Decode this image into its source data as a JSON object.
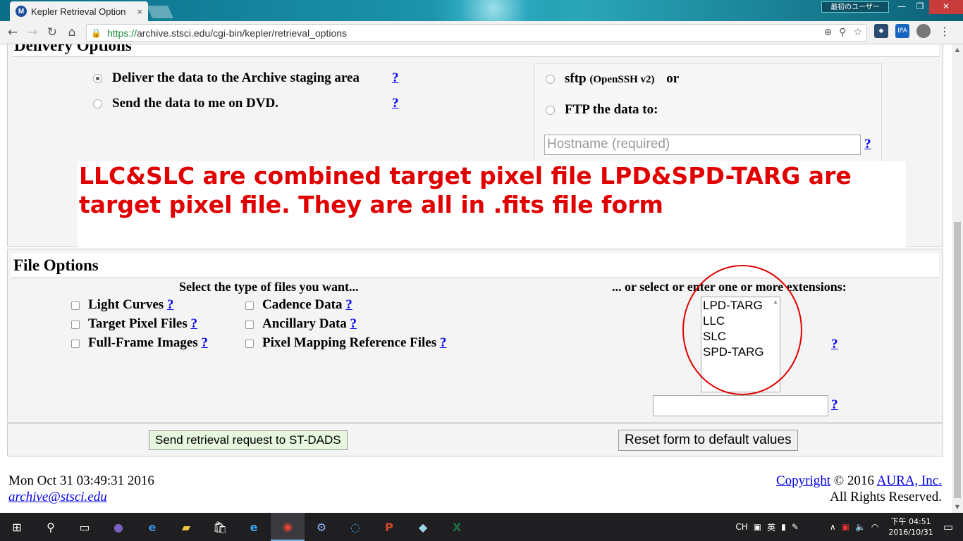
{
  "browser": {
    "tab_title": "Kepler Retrieval Option",
    "tab_close": "×",
    "url_scheme": "https://",
    "url_rest": "archive.stsci.edu/cgi-bin/kepler/retrieval_options",
    "user_label": "最初のユーザー",
    "ext_ipa": "IPA",
    "favicon_letter": "M"
  },
  "delivery": {
    "title": "Delivery Options",
    "staging_label": "Deliver the data to the Archive staging area",
    "dvd_label": "Send the data to me on DVD.",
    "sftp_label": "sftp",
    "sftp_sub": "(OpenSSH v2)",
    "or_label": "or",
    "ftp_label": "FTP the data to:",
    "hostname_placeholder": "Hostname (required)"
  },
  "annotation": {
    "text": "LLC&SLC are combined target pixel file LPD&SPD-TARG are target pixel file. They are all in .fits file form",
    "color": "#e00000"
  },
  "file_options": {
    "title": "File Options",
    "types_heading": "Select the type of files you want...",
    "ext_heading": "... or select or enter one or more extensions:",
    "col1": [
      "Light Curves",
      "Target Pixel Files",
      "Full-Frame Images"
    ],
    "col2": [
      "Cadence Data",
      "Ancillary Data",
      "Pixel Mapping Reference Files"
    ],
    "extensions": [
      "LPD-TARG",
      "LLC",
      "SLC",
      "SPD-TARG"
    ],
    "help": "?"
  },
  "actions": {
    "submit_label": "Send retrieval request to ST-DADS",
    "reset_label": "Reset form to default values"
  },
  "footer": {
    "date": "Mon Oct 31 03:49:31 2016",
    "email": "archive@stsci.edu",
    "copyright_link": "Copyright",
    "copyright_text": " © 2016 ",
    "aura_link": "AURA, Inc.",
    "rights": "All Rights Reserved."
  },
  "taskbar": {
    "ime_ch": "CH",
    "ime_en": "英",
    "time": "下午 04:51",
    "date": "2016/10/31"
  }
}
